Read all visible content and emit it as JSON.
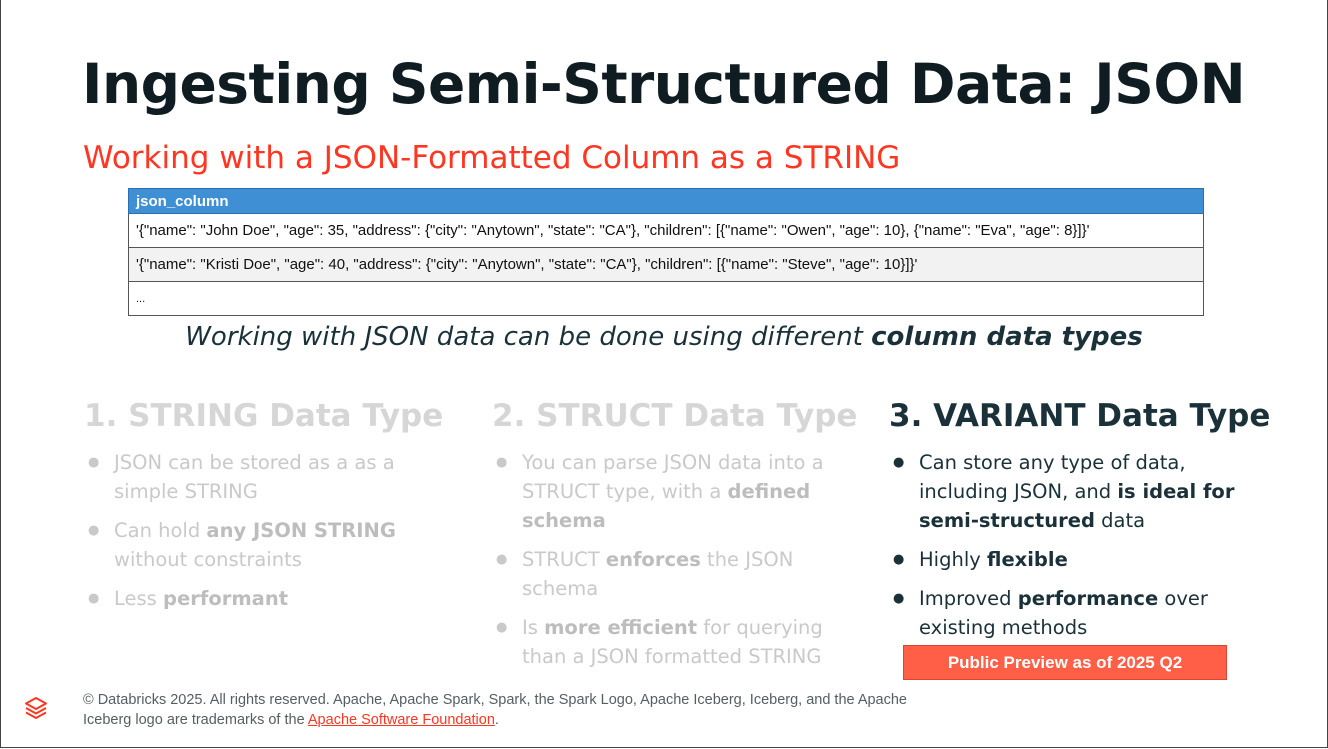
{
  "slide": {
    "title": "Ingesting Semi-Structured Data: JSON",
    "subtitle": "Working with a JSON-Formatted Column as a STRING"
  },
  "table": {
    "header": "json_column",
    "rows": [
      "'{\"name\": \"John Doe\", \"age\": 35, \"address\": {\"city\": \"Anytown\", \"state\": \"CA\"}, \"children\": [{\"name\": \"Owen\", \"age\": 10}, {\"name\": \"Eva\", \"age\": 8}]}'",
      "'{\"name\": \"Kristi Doe\", \"age\": 40, \"address\": {\"city\": \"Anytown\", \"state\": \"CA\"}, \"children\": [{\"name\": \"Steve\", \"age\": 10}]}'",
      "..."
    ]
  },
  "caption": {
    "text": "Working with JSON data can be done using different ",
    "bold": "column data types"
  },
  "columns": [
    {
      "heading": "1. STRING Data Type",
      "bullets": [
        [
          {
            "t": "JSON can be stored as a as a simple STRING"
          }
        ],
        [
          {
            "t": "Can hold "
          },
          {
            "t": "any JSON STRING",
            "b": true
          },
          {
            "t": " without constraints"
          }
        ],
        [
          {
            "t": "Less "
          },
          {
            "t": "performant",
            "b": true
          }
        ]
      ]
    },
    {
      "heading": "2. STRUCT Data Type",
      "bullets": [
        [
          {
            "t": "You can parse JSON data into a STRUCT type, with a "
          },
          {
            "t": "defined schema",
            "b": true
          }
        ],
        [
          {
            "t": "STRUCT "
          },
          {
            "t": "enforces",
            "b": true
          },
          {
            "t": " the JSON schema"
          }
        ],
        [
          {
            "t": "Is "
          },
          {
            "t": "more efficient",
            "b": true
          },
          {
            "t": " for querying than a JSON formatted STRING"
          }
        ]
      ]
    },
    {
      "heading": "3. VARIANT Data Type",
      "bullets": [
        [
          {
            "t": "Can store any type of data, including JSON, and "
          },
          {
            "t": "is ideal for semi-structured",
            "b": true
          },
          {
            "t": " data"
          }
        ],
        [
          {
            "t": "Highly "
          },
          {
            "t": "flexible",
            "b": true
          }
        ],
        [
          {
            "t": "Improved "
          },
          {
            "t": "performance",
            "b": true
          },
          {
            "t": " over existing methods"
          }
        ]
      ]
    }
  ],
  "badge": "Public Preview as of 2025 Q2",
  "footer": {
    "line1": "© Databricks 2025. All rights reserved. Apache, Apache Spark, Spark, the Spark Logo, Apache Iceberg, Iceberg, and the Apache",
    "line2_prefix": "Iceberg logo are trademarks of the ",
    "link": "Apache Software Foundation",
    "line2_suffix": "."
  },
  "colors": {
    "accent": "#ff3621",
    "table_header": "#3f8fd4",
    "dark_text": "#1b3139",
    "faded_text": "#c9c9c9",
    "badge": "#ff5f46"
  },
  "icons": {
    "logo": "databricks-logo-icon"
  }
}
